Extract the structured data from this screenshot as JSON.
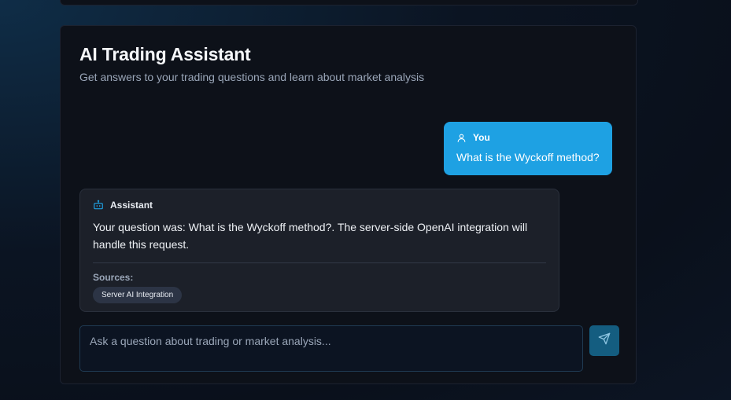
{
  "assistant_card": {
    "title": "AI Trading Assistant",
    "subtitle": "Get answers to your trading questions and learn about market analysis"
  },
  "messages": [
    {
      "role": "user",
      "author": "You",
      "icon": "user-icon",
      "text": "What is the Wyckoff method?"
    },
    {
      "role": "assistant",
      "author": "Assistant",
      "icon": "bot-icon",
      "text": "Your question was: What is the Wyckoff method?. The server-side OpenAI integration will handle this request.",
      "sources_label": "Sources:",
      "sources": [
        "Server AI Integration"
      ]
    }
  ],
  "composer": {
    "placeholder": "Ask a question about trading or market analysis...",
    "value": "",
    "send_icon": "send-icon"
  },
  "colors": {
    "accent": "#1ea1e3",
    "send_button": "#145d80",
    "card_background": "#0d1119",
    "assistant_bubble": "#1c2029",
    "chip_background": "#2c3445"
  }
}
